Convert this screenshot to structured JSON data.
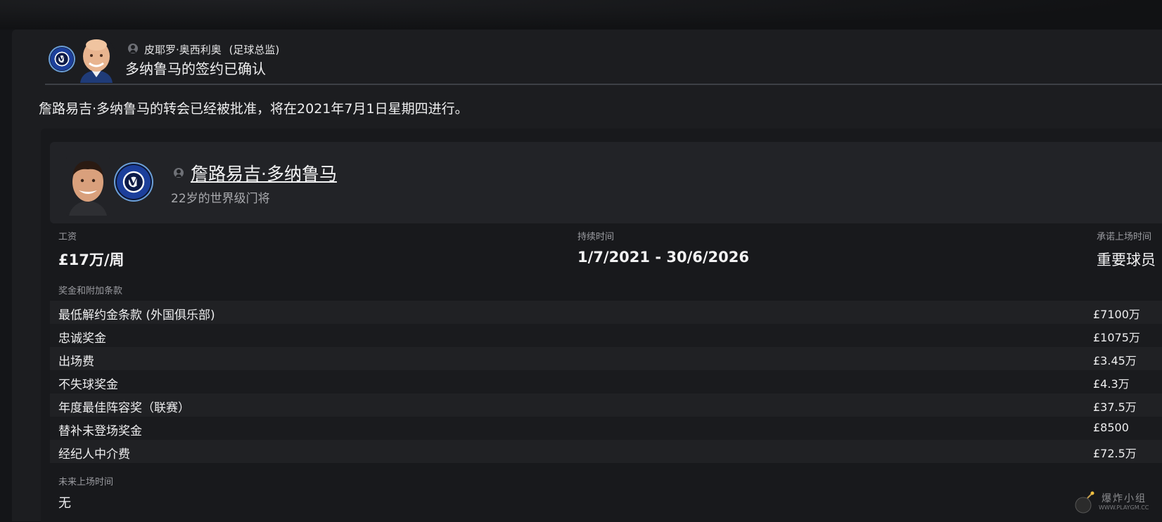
{
  "message": {
    "sender_name": "皮耶罗·奥西利奥",
    "sender_role": "(足球总监)",
    "subject": "多纳鲁马的签约已确认",
    "body": "詹路易吉·多纳鲁马的转会已经被批准，将在2021年7月1日星期四进行。"
  },
  "player": {
    "name": "詹路易吉·多纳鲁马",
    "description": "22岁的世界级门将"
  },
  "contract": {
    "wage_label": "工资",
    "wage_value": "£17万/周",
    "duration_label": "持续时间",
    "duration_value": "1/7/2021 - 30/6/2026",
    "playing_time_label": "承诺上场时间",
    "playing_time_value": "重要球员",
    "bonuses_label": "奖金和附加条款",
    "bonuses": [
      {
        "label": "最低解约金条款 (外国俱乐部)",
        "value": "£7100万"
      },
      {
        "label": "忠诚奖金",
        "value": "£1075万"
      },
      {
        "label": "出场费",
        "value": "£3.45万"
      },
      {
        "label": "不失球奖金",
        "value": "£4.3万"
      },
      {
        "label": "年度最佳阵容奖（联赛）",
        "value": "£37.5万"
      },
      {
        "label": "替补未登场奖金",
        "value": "£8500"
      },
      {
        "label": "经纪人中介费",
        "value": "£72.5万"
      }
    ],
    "future_playing_time_label": "未来上场时间",
    "future_playing_time_value": "无"
  },
  "watermark": {
    "text": "爆炸小组",
    "url": "WWW.PLAYGM.CC"
  },
  "colors": {
    "background": "#141518",
    "panel": "#1c1d20",
    "club_blue": "#1c3f9b"
  }
}
